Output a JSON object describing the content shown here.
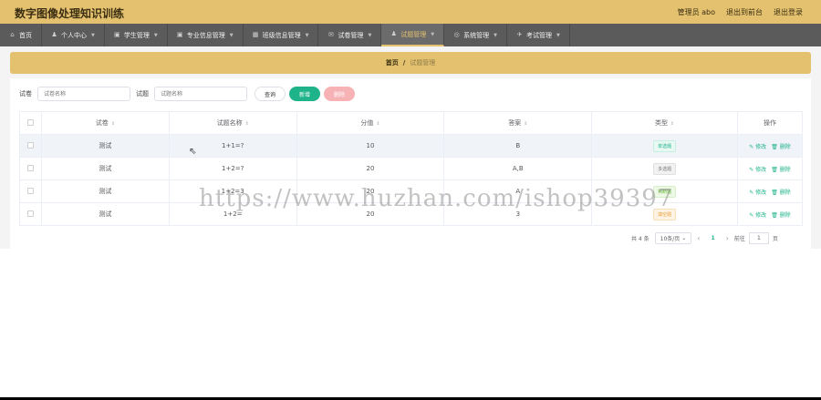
{
  "app": {
    "title": "数字图像处理知识训练"
  },
  "header": {
    "user": "管理员 abo",
    "back_front": "退出到前台",
    "logout": "退出登录"
  },
  "nav": [
    {
      "label": "首页",
      "icon": "⌂"
    },
    {
      "label": "个人中心",
      "icon": "♟"
    },
    {
      "label": "学生管理",
      "icon": "▣"
    },
    {
      "label": "专业信息管理",
      "icon": "▣"
    },
    {
      "label": "班级信息管理",
      "icon": "▦"
    },
    {
      "label": "试卷管理",
      "icon": "✉"
    },
    {
      "label": "试题管理",
      "icon": "♟"
    },
    {
      "label": "系统管理",
      "icon": "◎"
    },
    {
      "label": "考试管理",
      "icon": "✈"
    }
  ],
  "breadcrumb": {
    "home": "首页",
    "sep": "/",
    "current": "试题管理"
  },
  "search": {
    "paper_label": "试卷",
    "paper_placeholder": "试卷名称",
    "question_label": "试题",
    "question_placeholder": "试题名称",
    "query": "查询",
    "add": "新增",
    "delete": "删除"
  },
  "table": {
    "columns": [
      "试卷",
      "试题名称",
      "分值",
      "答案",
      "类型",
      "操作"
    ],
    "rows": [
      {
        "paper": "测试",
        "name": "1+1=?",
        "score": "10",
        "answer": "B",
        "type": "单选题",
        "edit": "修改",
        "del": "删除"
      },
      {
        "paper": "测试",
        "name": "1+2=?",
        "score": "20",
        "answer": "A,B",
        "type": "多选题",
        "edit": "修改",
        "del": "删除"
      },
      {
        "paper": "测试",
        "name": "1+2=3",
        "score": "20",
        "answer": "A",
        "type": "判断题",
        "edit": "修改",
        "del": "删除"
      },
      {
        "paper": "测试",
        "name": "1+2=",
        "score": "20",
        "answer": "3",
        "type": "填空题",
        "edit": "修改",
        "del": "删除"
      }
    ]
  },
  "pager": {
    "total": "共 4 条",
    "size": "10条/页",
    "prev": "‹",
    "current": "1",
    "next": "›",
    "goto": "前往",
    "goto_value": "1",
    "page_unit": "页"
  },
  "watermark": "https://www.huzhan.com/ishop39397",
  "colors": {
    "accent": "#e3c16e",
    "nav": "#5b5b5b",
    "green": "#1fb38a"
  }
}
